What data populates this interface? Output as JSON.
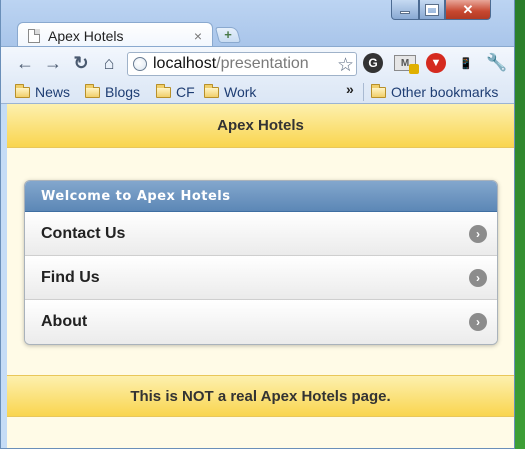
{
  "browser": {
    "tab_title": "Apex Hotels",
    "tab_close": "×",
    "newtab_label": "+",
    "address": {
      "host": "localhost",
      "path": "/presentation"
    },
    "bookmarks": [
      "News",
      "Blogs",
      "CF",
      "Work"
    ],
    "bookmarks_more": "»",
    "other_bookmarks": "Other bookmarks",
    "extensions": {
      "g": "G",
      "m": "M",
      "r": "▼"
    }
  },
  "page": {
    "header_title": "Apex Hotels",
    "list_divider": "Welcome to Apex Hotels",
    "list_items": [
      "Contact Us",
      "Find Us",
      "About"
    ],
    "footer_text": "This is NOT a real Apex Hotels page."
  },
  "colors": {
    "header_gradient_top": "#fdf0ae",
    "header_gradient_bottom": "#f9d54f",
    "divider_blue": "#5c87b6",
    "page_background": "#fffbe7"
  }
}
